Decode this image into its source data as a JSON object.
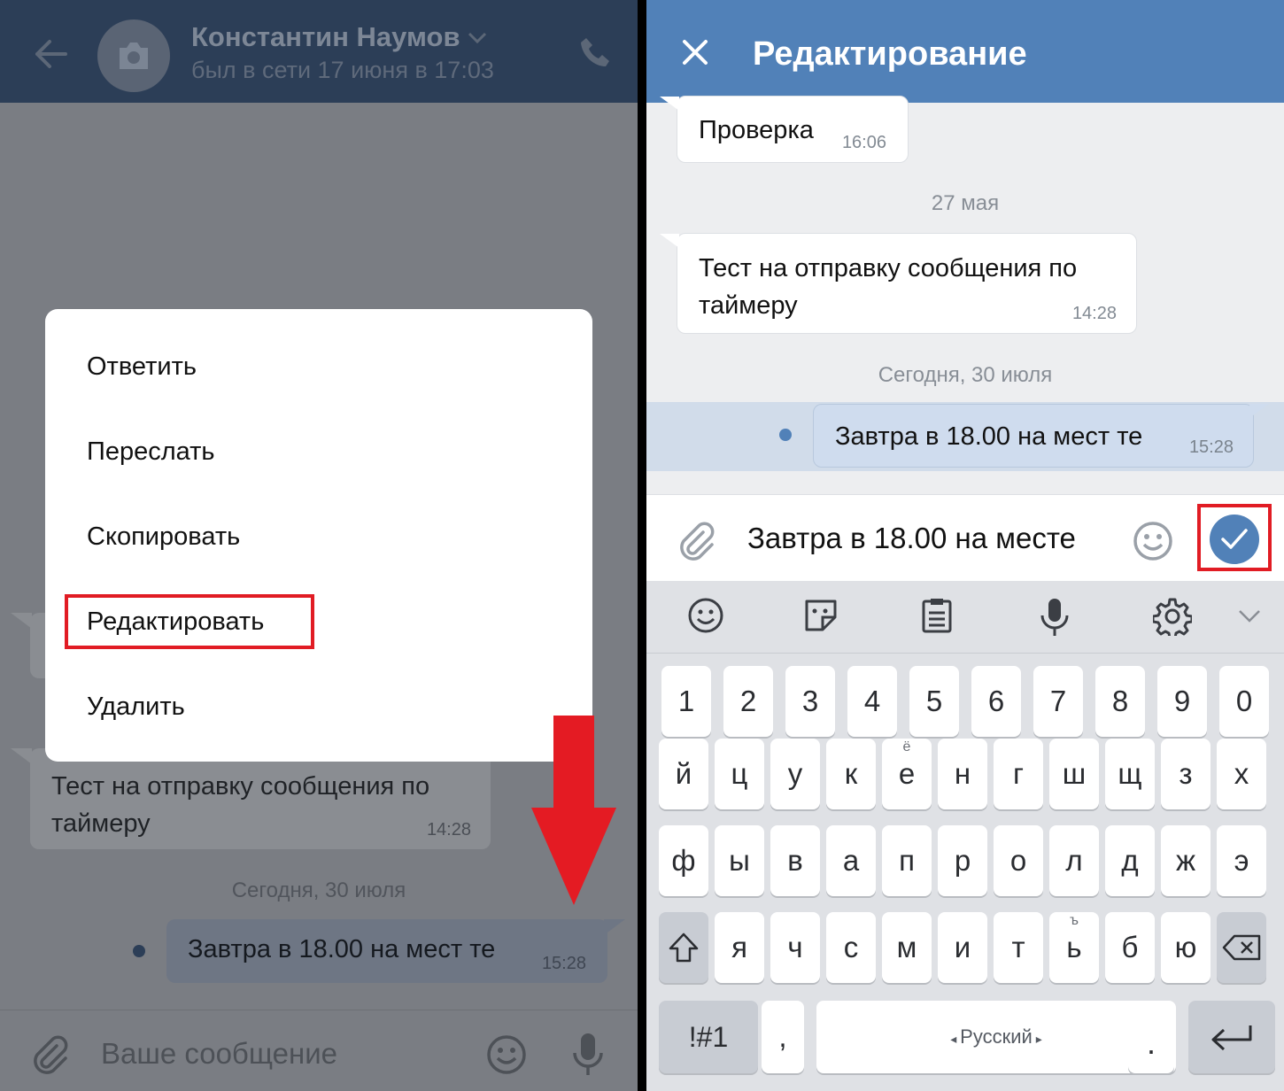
{
  "left": {
    "header": {
      "contact_name": "Константин Наумов",
      "status": "был в сети 17 июня в 17:03"
    },
    "context_menu": {
      "items": [
        "Ответить",
        "Переслать",
        "Скопировать",
        "Редактировать",
        "Удалить"
      ],
      "highlighted_item": "Редактировать"
    },
    "messages": {
      "incoming_text": "Тест на отправку сообщения по таймеру",
      "incoming_time": "14:28",
      "date_separator": "Сегодня, 30 июля",
      "outgoing_text": "Завтра в 18.00 на мест те",
      "outgoing_time": "15:28"
    },
    "compose": {
      "placeholder": "Ваше сообщение"
    }
  },
  "right": {
    "header": {
      "title": "Редактирование"
    },
    "messages": {
      "msg1_text": "Проверка",
      "msg1_time": "16:06",
      "date1": "27 мая",
      "msg2_text": "Тест на отправку сообщения по таймеру",
      "msg2_time": "14:28",
      "date2": "Сегодня, 30 июля",
      "selected_text": "Завтра в 18.00 на мест те",
      "selected_time": "15:28"
    },
    "compose": {
      "input_value": "Завтра в 18.00 на месте"
    },
    "keyboard": {
      "language": "Русский",
      "symbols_key": "!#1",
      "comma_key": ",",
      "period_key": ".",
      "row_numbers": [
        "1",
        "2",
        "3",
        "4",
        "5",
        "6",
        "7",
        "8",
        "9",
        "0"
      ],
      "row1": [
        "й",
        "ц",
        "у",
        "к",
        "е",
        "н",
        "г",
        "ш",
        "щ",
        "з",
        "х"
      ],
      "row1_sup_e": "ё",
      "row2": [
        "ф",
        "ы",
        "в",
        "а",
        "п",
        "р",
        "о",
        "л",
        "д",
        "ж",
        "э"
      ],
      "row3": [
        "я",
        "ч",
        "с",
        "м",
        "и",
        "т",
        "ь",
        "б",
        "ю"
      ],
      "row3_sup_soft": "ъ"
    }
  },
  "colors": {
    "vk_blue": "#5181b8",
    "highlight_red": "#e11c24"
  }
}
